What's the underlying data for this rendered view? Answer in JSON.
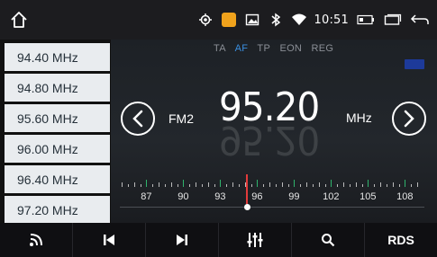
{
  "status": {
    "time": "10:51",
    "icons": [
      "home-icon",
      "location-icon",
      "camera-badge-icon",
      "image-icon",
      "bluetooth-icon",
      "wifi-icon",
      "battery-icon",
      "recent-apps-icon",
      "back-icon"
    ]
  },
  "presets": [
    {
      "label": "94.40 MHz"
    },
    {
      "label": "94.80 MHz"
    },
    {
      "label": "95.60 MHz"
    },
    {
      "label": "96.00 MHz"
    },
    {
      "label": "96.40 MHz"
    },
    {
      "label": "97.20 MHz"
    }
  ],
  "radio": {
    "flags": [
      "TA",
      "AF",
      "TP",
      "EON",
      "REG"
    ],
    "active_flag": "AF",
    "band": "FM2",
    "frequency": "95.20",
    "unit": "MHz",
    "dial_min": 85,
    "dial_max": 109,
    "dial_value": 95.2,
    "dial_labels": [
      "87",
      "90",
      "93",
      "96",
      "99",
      "102",
      "105",
      "108"
    ]
  },
  "bottombar": {
    "rds_label": "RDS",
    "icons": [
      "radio-signal-icon",
      "skip-previous-icon",
      "skip-next-icon",
      "equalizer-icon",
      "search-icon"
    ]
  },
  "colors": {
    "accent_blue": "#3a8fe0",
    "needle_red": "#e23b3b",
    "tick_green": "#2fb36c",
    "camera_orange": "#f0a21c"
  }
}
